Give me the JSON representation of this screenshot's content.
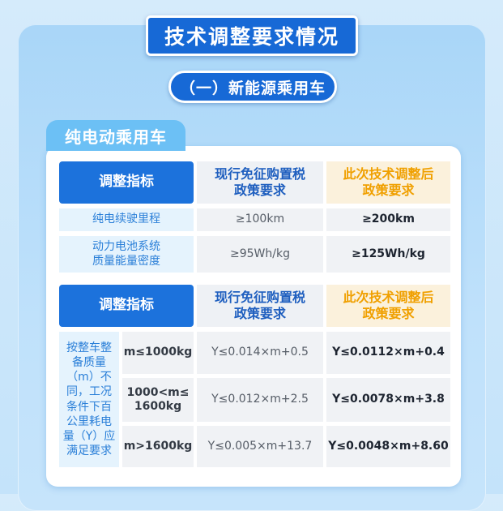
{
  "header": {
    "title": "技术调整要求情况"
  },
  "section": {
    "subtitle": "（一）新能源乘用车"
  },
  "card": {
    "tab_label": "纯电动乘用车"
  },
  "table1": {
    "col_headers": [
      "调整指标",
      "现行免征购置税\n政策要求",
      "此次技术调整后\n政策要求"
    ],
    "rows": [
      {
        "label": "纯电续驶里程",
        "current": "≥100km",
        "new": "≥200km"
      },
      {
        "label": "动力电池系统\n质量能量密度",
        "current": "≥95Wh/kg",
        "new": "≥125Wh/kg"
      }
    ]
  },
  "table2": {
    "col_headers": [
      "调整指标",
      "现行免征购置税\n政策要求",
      "此次技术调整后\n政策要求"
    ],
    "side_label": "按整车整\n备质量\n（m）不\n同，工况\n条件下百\n公里耗电\n量（Y）应\n满足要求",
    "rows": [
      {
        "mass": "m≤1000kg",
        "current": "Y≤0.014×m+0.5",
        "new": "Y≤0.0112×m+0.4"
      },
      {
        "mass": "1000<m≤\n1600kg",
        "current": "Y≤0.012×m+2.5",
        "new": "Y≤0.0078×m+3.8"
      },
      {
        "mass": "m>1600kg",
        "current": "Y≤0.005×m+13.7",
        "new": "Y≤0.0048×m+8.60"
      }
    ]
  },
  "colors": {
    "primary_blue": "#1769d6",
    "header_blue": "#1c72dc",
    "new_policy_orange": "#f0a000",
    "label_blue": "#2a7fd8"
  }
}
